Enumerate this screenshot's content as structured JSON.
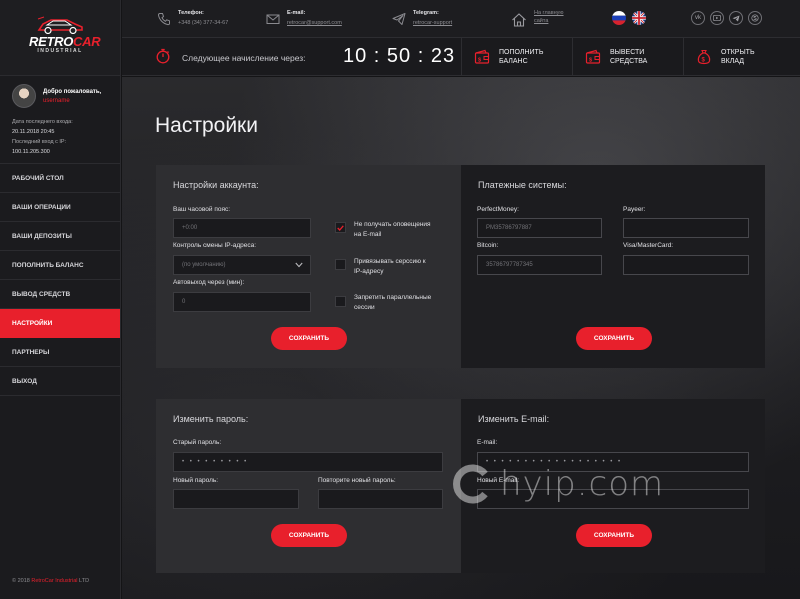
{
  "brand": {
    "logo_word_white": "RETRO",
    "logo_word_red": "CAR",
    "logo_sub": "INDUSTRIAL",
    "accent": "#e8202c"
  },
  "user": {
    "welcome": "Добро пожаловать,",
    "username": "username",
    "last_login_label": "Дата последнего входа:",
    "last_login_value": "20.11.2018 20:45",
    "last_ip_label": "Последний вход с IP:",
    "last_ip_value": "100.11.205.300"
  },
  "nav": [
    {
      "label": "Рабочий стол",
      "active": false
    },
    {
      "label": "Ваши операции",
      "active": false
    },
    {
      "label": "Ваши депозиты",
      "active": false
    },
    {
      "label": "Пополнить баланс",
      "active": false
    },
    {
      "label": "Вывод средств",
      "active": false
    },
    {
      "label": "Настройки",
      "active": true
    },
    {
      "label": "Партнеры",
      "active": false
    },
    {
      "label": "Выход",
      "active": false
    }
  ],
  "footer": {
    "copyright_prefix": "© 2018 ",
    "copyright_brand": "RetroCar Industrial",
    "copyright_suffix": " LTD"
  },
  "topbar": {
    "phone_label": "Телефон:",
    "phone_value": "+348 (34) 377-34-67",
    "email_label": "E-mail:",
    "email_value": "retrocar@support.com",
    "telegram_label": "Telegram:",
    "telegram_value": "retrocar-support",
    "home_line1": "На главную",
    "home_line2": "сайта",
    "social": [
      "vk-icon",
      "youtube-icon",
      "telegram-icon",
      "skype-icon"
    ]
  },
  "timerbar": {
    "label": "Следующее начисление через:",
    "hours": "10",
    "minutes": "50",
    "seconds": "23",
    "actions": [
      {
        "line1": "Пополнить",
        "line2": "баланс",
        "icon": "wallet-in-icon"
      },
      {
        "line1": "Вывести",
        "line2": "средства",
        "icon": "wallet-out-icon"
      },
      {
        "line1": "Открыть",
        "line2": "вклад",
        "icon": "money-bag-icon"
      }
    ]
  },
  "page": {
    "title": "Настройки"
  },
  "account": {
    "title": "Настройки аккаунта:",
    "timezone_label": "Ваш часовой пояс:",
    "timezone_value": "+0:00",
    "ip_label": "Контроль смены IP-адреса:",
    "ip_value": "(по умолчанию)",
    "autologout_label": "Автовыход через (мин):",
    "autologout_value": "0",
    "checkboxes": [
      {
        "line1": "Не получать оповещения",
        "line2": "на E-mail",
        "checked": true
      },
      {
        "line1": "Привязывать серссию к",
        "line2": "IP-адресу",
        "checked": false
      },
      {
        "line1": "Запретить параллельные",
        "line2": "сессии",
        "checked": false
      }
    ],
    "save": "Сохранить"
  },
  "payments": {
    "title": "Платежные системы:",
    "perfectmoney_label": "PerfectMoney:",
    "perfectmoney_value": "PM35786797887",
    "payeer_label": "Payeer:",
    "payeer_value": "",
    "bitcoin_label": "Bitcoin:",
    "bitcoin_value": "35786797787345",
    "visa_label": "Visa/MasterCard:",
    "visa_value": "",
    "save": "Сохранить"
  },
  "password": {
    "title": "Изменить пароль:",
    "old_label": "Старый пароль:",
    "old_value": "• • • • • • • • •",
    "new_label": "Новый пароль:",
    "new_value": "",
    "repeat_label": "Повторите новый пароль:",
    "repeat_value": "",
    "save": "Сохранить"
  },
  "email_change": {
    "title": "Изменить E-mail:",
    "email_label": "E-mail:",
    "email_value": "• • • • • • • • • • • • • • • • • •",
    "new_email_label": "Новый E-mail:",
    "new_email_value": "",
    "save": "Сохранить"
  },
  "watermark": {
    "text": "hyip.com"
  }
}
